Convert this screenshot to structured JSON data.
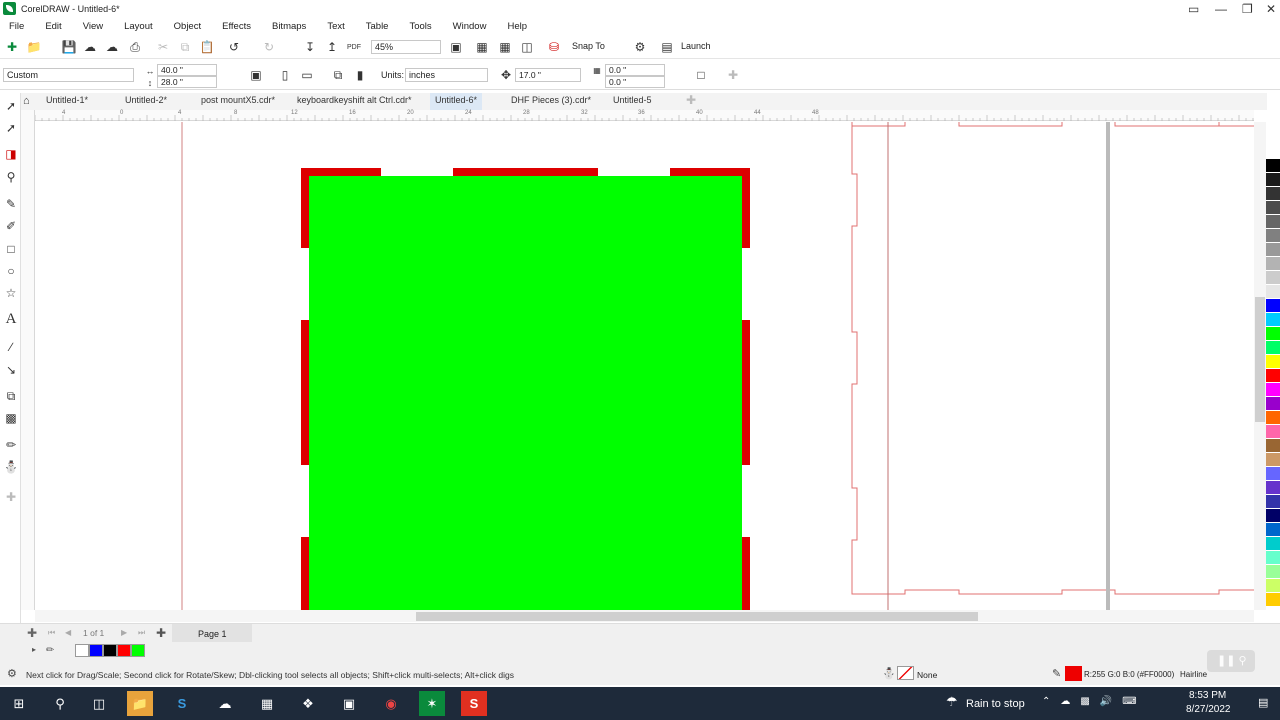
{
  "window": {
    "title": "CorelDRAW - Untitled-6*"
  },
  "menu": [
    "File",
    "Edit",
    "View",
    "Layout",
    "Object",
    "Effects",
    "Bitmaps",
    "Text",
    "Table",
    "Tools",
    "Window",
    "Help"
  ],
  "toolbar": {
    "zoom": "45%",
    "snap_label": "Snap To",
    "launch_label": "Launch"
  },
  "property_bar": {
    "page_preset": "Custom",
    "page_width": "40.0 \"",
    "page_height": "28.0 \"",
    "units_label": "Units:",
    "units_value": "inches",
    "nudge": "17.0 \"",
    "dup_x": "0.0 \"",
    "dup_y": "0.0 \""
  },
  "doc_tabs": [
    "Untitled-1*",
    "Untitled-2*",
    "post mountX5.cdr*",
    "keyboardkeyshift alt Ctrl.cdr*",
    "Untitled-6*",
    "DHF Pieces (3).cdr*",
    "Untitled-5"
  ],
  "active_tab": "Untitled-6*",
  "ruler_h": [
    "4",
    "0",
    "4",
    "8",
    "12",
    "16",
    "20",
    "24",
    "28",
    "32",
    "36",
    "40",
    "44",
    "48"
  ],
  "pager": {
    "count": "1 of 1",
    "page_tab": "Page 1"
  },
  "status": {
    "hint": "Next click for Drag/Scale; Second click for Rotate/Skew; Dbl-clicking tool selects all objects; Shift+click multi-selects; Alt+click digs",
    "fill": "None",
    "outline": "R:255 G:0 B:0 (#FF0000)",
    "outline_width": "Hairline"
  },
  "colors": {
    "green_fill": "#00ff00",
    "red_tab": "#dd0000",
    "outline_red": "#e07070"
  },
  "doc_palette": [
    "#ffffff",
    "#0000ff",
    "#000000",
    "#ff0000",
    "#00ff00"
  ],
  "palette": [
    "#ffffff",
    "#000000",
    "#1a1a1a",
    "#333333",
    "#4d4d4d",
    "#666666",
    "#808080",
    "#999999",
    "#b3b3b3",
    "#cccccc",
    "#e6e6e6",
    "#0000ff",
    "#00ccff",
    "#00ff00",
    "#00ff66",
    "#ffff00",
    "#ff0000",
    "#ff00ff",
    "#9900cc",
    "#ff6600",
    "#ff66aa",
    "#996633",
    "#cc9966",
    "#6666ff",
    "#6633cc",
    "#3333aa",
    "#000066",
    "#0066cc",
    "#00cccc",
    "#66ffcc",
    "#99ff99",
    "#ccff66",
    "#ffcc00"
  ],
  "taskbar": {
    "weather": "Rain to stop",
    "time": "8:53 PM",
    "date": "8/27/2022"
  }
}
